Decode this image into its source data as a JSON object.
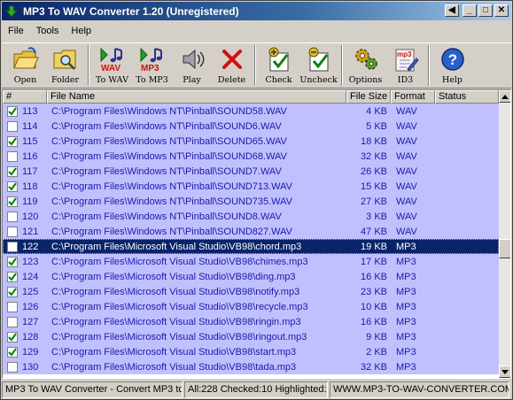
{
  "window": {
    "title": "MP3 To WAV Converter 1.20  (Unregistered)",
    "controls": {
      "back": "◀",
      "minimize": "_",
      "maximize": "□",
      "close": "✕"
    }
  },
  "menu": [
    "File",
    "Tools",
    "Help"
  ],
  "toolbar": {
    "open": "Open",
    "folder": "Folder",
    "to_wav": "To WAV",
    "to_mp3": "To MP3",
    "play": "Play",
    "delete": "Delete",
    "check": "Check",
    "uncheck": "Uncheck",
    "options": "Options",
    "id3": "ID3",
    "help": "Help",
    "icon_text_wav": "WAV",
    "icon_text_mp3": "MP3",
    "icon_text_id3": "mp3"
  },
  "columns": [
    "#",
    "File Name",
    "File Size",
    "Format",
    "Status"
  ],
  "rows": [
    {
      "num": "113",
      "name": "C:\\Program Files\\Windows NT\\Pinball\\SOUND58.WAV",
      "size": "4 KB",
      "format": "WAV",
      "checked": true
    },
    {
      "num": "114",
      "name": "C:\\Program Files\\Windows NT\\Pinball\\SOUND6.WAV",
      "size": "5 KB",
      "format": "WAV",
      "checked": false
    },
    {
      "num": "115",
      "name": "C:\\Program Files\\Windows NT\\Pinball\\SOUND65.WAV",
      "size": "18 KB",
      "format": "WAV",
      "checked": true
    },
    {
      "num": "116",
      "name": "C:\\Program Files\\Windows NT\\Pinball\\SOUND68.WAV",
      "size": "32 KB",
      "format": "WAV",
      "checked": false
    },
    {
      "num": "117",
      "name": "C:\\Program Files\\Windows NT\\Pinball\\SOUND7.WAV",
      "size": "26 KB",
      "format": "WAV",
      "checked": true
    },
    {
      "num": "118",
      "name": "C:\\Program Files\\Windows NT\\Pinball\\SOUND713.WAV",
      "size": "15 KB",
      "format": "WAV",
      "checked": true
    },
    {
      "num": "119",
      "name": "C:\\Program Files\\Windows NT\\Pinball\\SOUND735.WAV",
      "size": "27 KB",
      "format": "WAV",
      "checked": true
    },
    {
      "num": "120",
      "name": "C:\\Program Files\\Windows NT\\Pinball\\SOUND8.WAV",
      "size": "3 KB",
      "format": "WAV",
      "checked": false
    },
    {
      "num": "121",
      "name": "C:\\Program Files\\Windows NT\\Pinball\\SOUND827.WAV",
      "size": "47 KB",
      "format": "WAV",
      "checked": false
    },
    {
      "num": "122",
      "name": "C:\\Program Files\\Microsoft Visual Studio\\VB98\\chord.mp3",
      "size": "19 KB",
      "format": "MP3",
      "checked": false,
      "selected": true
    },
    {
      "num": "123",
      "name": "C:\\Program Files\\Microsoft Visual Studio\\VB98\\chimes.mp3",
      "size": "17 KB",
      "format": "MP3",
      "checked": true
    },
    {
      "num": "124",
      "name": "C:\\Program Files\\Microsoft Visual Studio\\VB98\\ding.mp3",
      "size": "16 KB",
      "format": "MP3",
      "checked": true
    },
    {
      "num": "125",
      "name": "C:\\Program Files\\Microsoft Visual Studio\\VB98\\notify.mp3",
      "size": "23 KB",
      "format": "MP3",
      "checked": true
    },
    {
      "num": "126",
      "name": "C:\\Program Files\\Microsoft Visual Studio\\VB98\\recycle.mp3",
      "size": "10 KB",
      "format": "MP3",
      "checked": false
    },
    {
      "num": "127",
      "name": "C:\\Program Files\\Microsoft Visual Studio\\VB98\\ringin.mp3",
      "size": "16 KB",
      "format": "MP3",
      "checked": false
    },
    {
      "num": "128",
      "name": "C:\\Program Files\\Microsoft Visual Studio\\VB98\\ringout.mp3",
      "size": "9 KB",
      "format": "MP3",
      "checked": true
    },
    {
      "num": "129",
      "name": "C:\\Program Files\\Microsoft Visual Studio\\VB98\\start.mp3",
      "size": "2 KB",
      "format": "MP3",
      "checked": true
    },
    {
      "num": "130",
      "name": "C:\\Program Files\\Microsoft Visual Studio\\VB98\\tada.mp3",
      "size": "32 KB",
      "format": "MP3",
      "checked": false
    }
  ],
  "scroll": {
    "thumb_position": 0.56
  },
  "statusbar": {
    "description": "MP3 To WAV Converter - Convert MP3 to",
    "counts": "All:228 Checked:10 Highlighted:1",
    "website": "WWW.MP3-TO-WAV-CONVERTER.COM"
  },
  "colors": {
    "row_bg": "#c0c0ff",
    "row_text": "#1a1aa8",
    "selected_bg": "#0a246a",
    "check_mark": "#008000"
  }
}
